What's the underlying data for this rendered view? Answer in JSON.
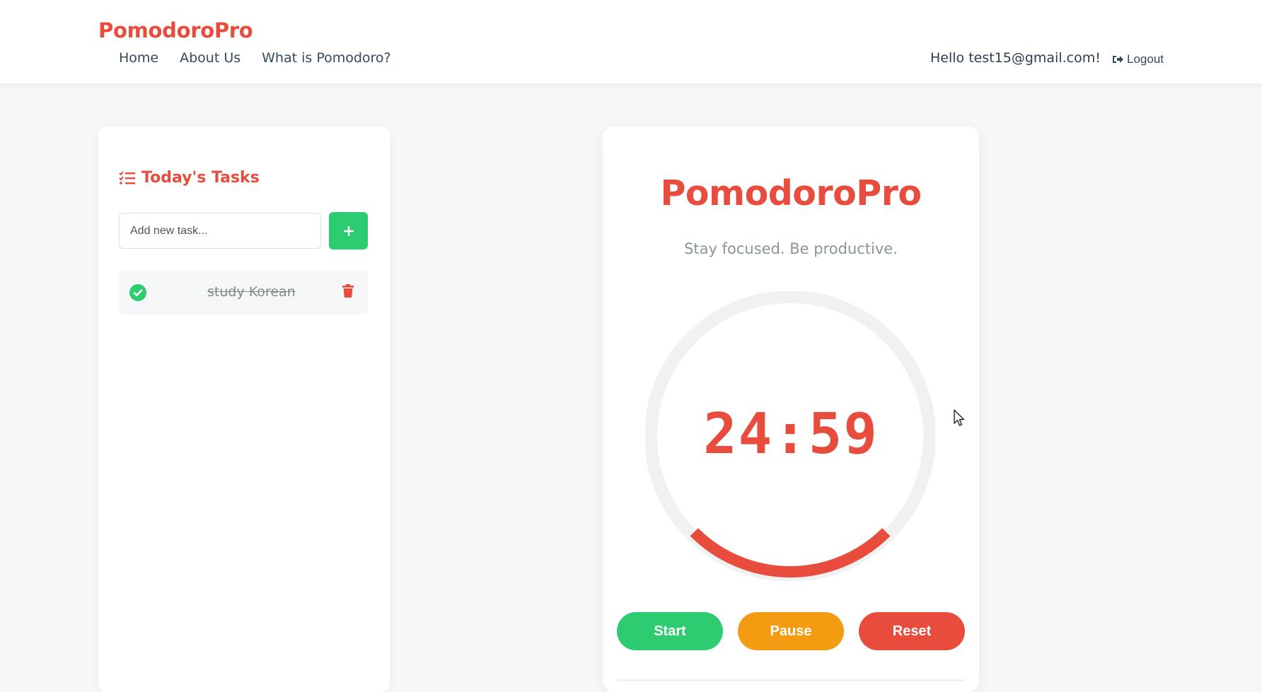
{
  "header": {
    "brand": "PomodoroPro",
    "nav": [
      {
        "label": "Home"
      },
      {
        "label": "About Us"
      },
      {
        "label": "What is Pomodoro?"
      }
    ],
    "greeting": "Hello test15@gmail.com!",
    "logout_label": "Logout",
    "logout_icon": "sign-out-icon"
  },
  "tasks": {
    "title": "Today's Tasks",
    "title_icon": "list-check-icon",
    "input_placeholder": "Add new task...",
    "input_value": "",
    "add_icon": "plus-icon",
    "items": [
      {
        "text": "study Korean",
        "completed": true
      }
    ]
  },
  "timer": {
    "title": "PomodoroPro",
    "subtitle": "Stay focused. Be productive.",
    "time": "24:59",
    "progress_fraction": 0.25,
    "buttons": {
      "start": "Start",
      "pause": "Pause",
      "reset": "Reset"
    }
  },
  "colors": {
    "accent": "#e74c3c",
    "success": "#2ecc71",
    "warning": "#f39c12",
    "text": "#2c3e50",
    "muted": "#8a9596",
    "background": "#f6f8f8"
  }
}
